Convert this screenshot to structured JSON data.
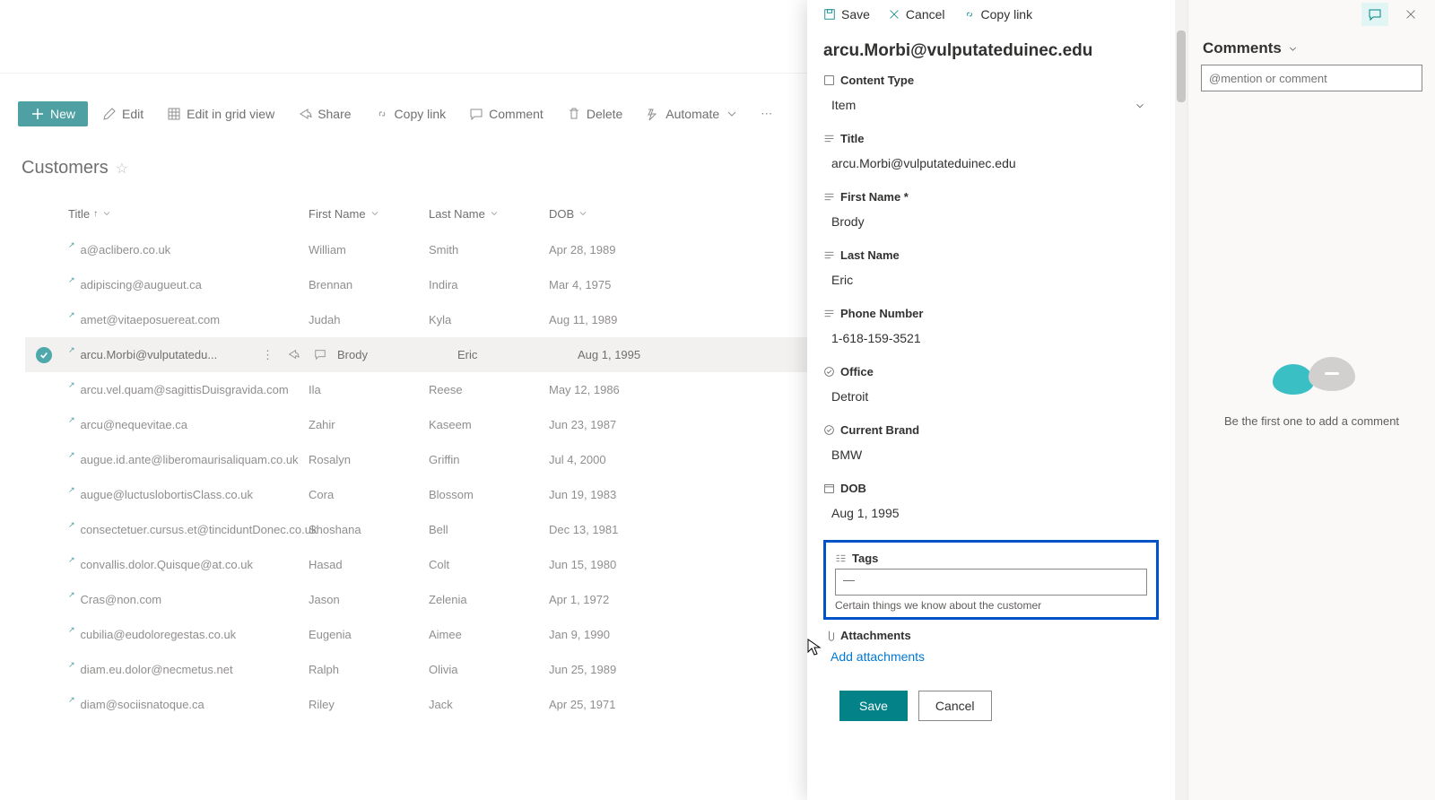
{
  "toolbar": {
    "new": "New",
    "edit": "Edit",
    "grid": "Edit in grid view",
    "share": "Share",
    "copylink": "Copy link",
    "comment": "Comment",
    "delete": "Delete",
    "automate": "Automate"
  },
  "list": {
    "title": "Customers",
    "headers": {
      "title": "Title",
      "first_name": "First Name",
      "last_name": "Last Name",
      "dob": "DOB"
    },
    "rows": [
      {
        "title": "a@aclibero.co.uk",
        "fn": "William",
        "ln": "Smith",
        "dob": "Apr 28, 1989",
        "selected": false
      },
      {
        "title": "adipiscing@augueut.ca",
        "fn": "Brennan",
        "ln": "Indira",
        "dob": "Mar 4, 1975",
        "selected": false
      },
      {
        "title": "amet@vitaeposuereat.com",
        "fn": "Judah",
        "ln": "Kyla",
        "dob": "Aug 11, 1989",
        "selected": false
      },
      {
        "title": "arcu.Morbi@vulputatedu...",
        "fn": "Brody",
        "ln": "Eric",
        "dob": "Aug 1, 1995",
        "selected": true
      },
      {
        "title": "arcu.vel.quam@sagittisDuisgravida.com",
        "fn": "Ila",
        "ln": "Reese",
        "dob": "May 12, 1986",
        "selected": false
      },
      {
        "title": "arcu@nequevitae.ca",
        "fn": "Zahir",
        "ln": "Kaseem",
        "dob": "Jun 23, 1987",
        "selected": false
      },
      {
        "title": "augue.id.ante@liberomaurisaliquam.co.uk",
        "fn": "Rosalyn",
        "ln": "Griffin",
        "dob": "Jul 4, 2000",
        "selected": false
      },
      {
        "title": "augue@luctuslobortisClass.co.uk",
        "fn": "Cora",
        "ln": "Blossom",
        "dob": "Jun 19, 1983",
        "selected": false
      },
      {
        "title": "consectetuer.cursus.et@tinciduntDonec.co.uk",
        "fn": "Shoshana",
        "ln": "Bell",
        "dob": "Dec 13, 1981",
        "selected": false
      },
      {
        "title": "convallis.dolor.Quisque@at.co.uk",
        "fn": "Hasad",
        "ln": "Colt",
        "dob": "Jun 15, 1980",
        "selected": false
      },
      {
        "title": "Cras@non.com",
        "fn": "Jason",
        "ln": "Zelenia",
        "dob": "Apr 1, 1972",
        "selected": false
      },
      {
        "title": "cubilia@eudoloregestas.co.uk",
        "fn": "Eugenia",
        "ln": "Aimee",
        "dob": "Jan 9, 1990",
        "selected": false
      },
      {
        "title": "diam.eu.dolor@necmetus.net",
        "fn": "Ralph",
        "ln": "Olivia",
        "dob": "Jun 25, 1989",
        "selected": false
      },
      {
        "title": "diam@sociisnatoque.ca",
        "fn": "Riley",
        "ln": "Jack",
        "dob": "Apr 25, 1971",
        "selected": false
      }
    ]
  },
  "panel": {
    "top": {
      "save": "Save",
      "cancel": "Cancel",
      "copylink": "Copy link"
    },
    "title": "arcu.Morbi@vulputateduinec.edu",
    "fields": {
      "content_type": {
        "label": "Content Type",
        "value": "Item"
      },
      "title": {
        "label": "Title",
        "value": "arcu.Morbi@vulputateduinec.edu"
      },
      "first_name": {
        "label": "First Name *",
        "value": "Brody"
      },
      "last_name": {
        "label": "Last Name",
        "value": "Eric"
      },
      "phone": {
        "label": "Phone Number",
        "value": "1-618-159-3521"
      },
      "office": {
        "label": "Office",
        "value": "Detroit"
      },
      "brand": {
        "label": "Current Brand",
        "value": "BMW"
      },
      "dob": {
        "label": "DOB",
        "value": "Aug 1, 1995"
      },
      "tags": {
        "label": "Tags",
        "value": "—",
        "hint": "Certain things we know about the customer"
      },
      "attachments": {
        "label": "Attachments",
        "add": "Add attachments"
      }
    },
    "footer": {
      "save": "Save",
      "cancel": "Cancel"
    }
  },
  "comments": {
    "title": "Comments",
    "placeholder": "@mention or comment",
    "empty": "Be the first one to add a comment"
  }
}
